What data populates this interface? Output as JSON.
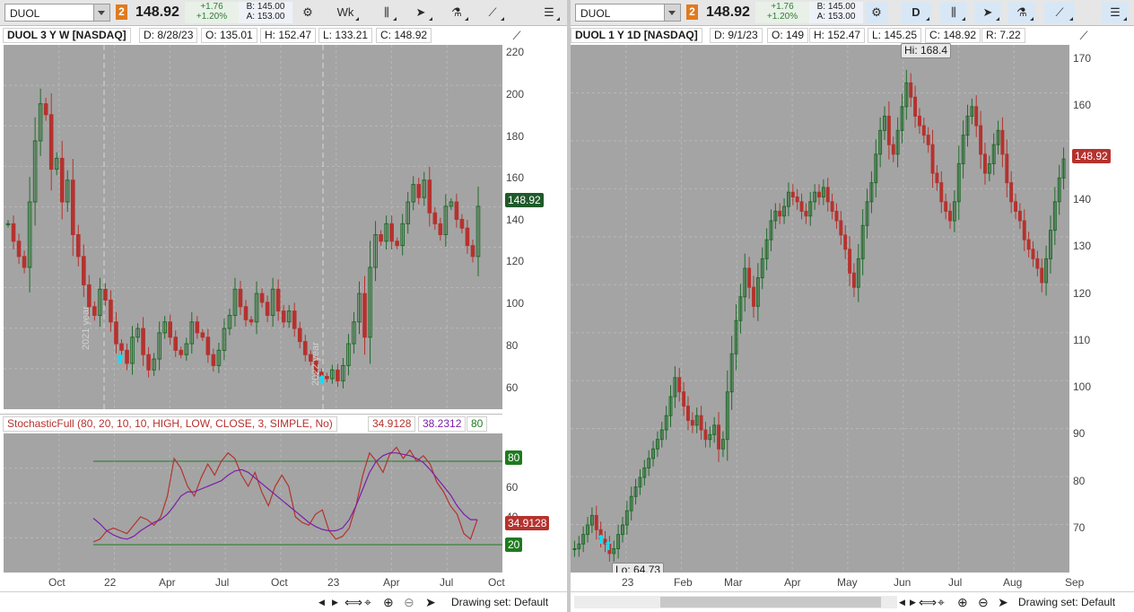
{
  "colors": {
    "up": "#1f6b2a",
    "down": "#b5322e",
    "plot_bg": "#a4a4a4",
    "stoch_k": "#b5322e",
    "stoch_d": "#7a1fa8",
    "level": "#1f7a1f",
    "arrow": "#00e5ff"
  },
  "left": {
    "symbol": "DUOL",
    "badge": "2",
    "last": "148.92",
    "change": "+1.76",
    "change_pct": "+1.20%",
    "bid": "B: 145.00",
    "ask": "A: 153.00",
    "aggregation": "Wk",
    "info": {
      "title": "DUOL 3 Y W [NASDAQ]",
      "date": "D: 8/28/23",
      "open": "O: 135.01",
      "high": "H: 152.47",
      "low": "L: 133.21",
      "close": "C: 148.92"
    },
    "price_tag": "148.92",
    "y_ticks": [
      "220",
      "200",
      "180",
      "160",
      "140",
      "120",
      "100",
      "80",
      "60"
    ],
    "x_ticks": [
      "Oct",
      "22",
      "Apr",
      "Jul",
      "Oct",
      "23",
      "Apr",
      "Jul",
      "Oct"
    ],
    "year_marks": [
      "2021 year",
      "2022 year"
    ],
    "study": {
      "label": "StochasticFull (80, 20, 10, 10, HIGH, LOW, CLOSE, 3, SIMPLE, No)",
      "k": "34.9128",
      "d": "38.2312",
      "ob": "80",
      "y_ticks": [
        "80",
        "60",
        "40",
        "20"
      ],
      "tag_k": "34.9128",
      "tag_ob": "80",
      "tag_os": "20"
    },
    "drawing_set": "Drawing set: Default"
  },
  "right": {
    "symbol": "DUOL",
    "badge": "2",
    "last": "148.92",
    "change": "+1.76",
    "change_pct": "+1.20%",
    "bid": "B: 145.00",
    "ask": "A: 153.00",
    "aggregation": "D",
    "info": {
      "title": "DUOL 1 Y 1D [NASDAQ]",
      "date": "D: 9/1/23",
      "open": "O: 149",
      "high": "H: 152.47",
      "low": "L: 145.25",
      "close": "C: 148.92",
      "range": "R: 7.22"
    },
    "price_tag": "148.92",
    "hi_label": "Hi: 168.4",
    "lo_label": "Lo: 64.73",
    "y_ticks": [
      "170",
      "160",
      "150",
      "140",
      "130",
      "120",
      "110",
      "100",
      "90",
      "80",
      "70"
    ],
    "x_ticks": [
      "23",
      "Feb",
      "Mar",
      "Apr",
      "May",
      "Jun",
      "Jul",
      "Aug",
      "Sep"
    ],
    "drawing_set": "Drawing set: Default"
  },
  "chart_data": [
    {
      "type": "candlestick",
      "title": "DUOL 3 Y W [NASDAQ]",
      "ylim": [
        55,
        222
      ],
      "closes": [
        140,
        132,
        125,
        120,
        150,
        178,
        195,
        190,
        165,
        170,
        150,
        160,
        135,
        125,
        112,
        102,
        98,
        110,
        105,
        95,
        85,
        82,
        76,
        88,
        92,
        80,
        73,
        78,
        90,
        95,
        88,
        82,
        80,
        85,
        95,
        90,
        88,
        80,
        75,
        82,
        92,
        98,
        110,
        102,
        96,
        95,
        108,
        104,
        98,
        110,
        100,
        95,
        100,
        92,
        86,
        80,
        77,
        72,
        70,
        69,
        73,
        68,
        75,
        85,
        95,
        108,
        88,
        120,
        135,
        132,
        140,
        132,
        130,
        140,
        150,
        158,
        152,
        160,
        145,
        140,
        135,
        148,
        150,
        142,
        138,
        130,
        125,
        148
      ],
      "stoch_k": [
        22,
        24,
        30,
        32,
        30,
        28,
        34,
        40,
        38,
        34,
        40,
        55,
        82,
        75,
        62,
        55,
        68,
        78,
        70,
        80,
        86,
        82,
        70,
        62,
        72,
        58,
        48,
        62,
        70,
        62,
        40,
        36,
        34,
        42,
        45,
        30,
        24,
        26,
        32,
        48,
        70,
        86,
        80,
        72,
        85,
        90,
        82,
        88,
        80,
        84,
        78,
        65,
        58,
        48,
        42,
        28,
        24,
        38
      ],
      "stoch_d": [
        39,
        35,
        30,
        27,
        25,
        24,
        26,
        30,
        33,
        36,
        38,
        42,
        48,
        55,
        58,
        58,
        60,
        62,
        64,
        66,
        70,
        73,
        74,
        72,
        68,
        64,
        60,
        56,
        52,
        48,
        44,
        40,
        36,
        33,
        31,
        30,
        30,
        32,
        38,
        48,
        60,
        72,
        80,
        84,
        86,
        86,
        85,
        84,
        82,
        79,
        74,
        68,
        62,
        56,
        48,
        42,
        38,
        38
      ]
    },
    {
      "type": "candlestick",
      "title": "DUOL 1 Y 1D [NASDAQ]",
      "ylim": [
        62,
        173
      ],
      "closes": [
        67,
        68,
        70,
        72,
        74,
        71,
        69,
        68,
        66,
        67,
        70,
        72,
        75,
        78,
        80,
        82,
        84,
        86,
        88,
        90,
        92,
        95,
        99,
        103,
        100,
        97,
        94,
        93,
        95,
        92,
        90,
        91,
        93,
        88,
        90,
        100,
        108,
        115,
        120,
        126,
        122,
        118,
        124,
        128,
        132,
        136,
        138,
        137,
        139,
        142,
        141,
        140,
        138,
        137,
        140,
        142,
        141,
        143,
        140,
        138,
        136,
        133,
        130,
        125,
        122,
        128,
        135,
        140,
        144,
        150,
        155,
        158,
        152,
        150,
        155,
        160,
        165,
        162,
        158,
        156,
        154,
        152,
        146,
        144,
        140,
        138,
        136,
        140,
        148,
        154,
        158,
        160,
        156,
        150,
        146,
        148,
        152,
        155,
        150,
        144,
        140,
        138,
        136,
        132,
        130,
        128,
        126,
        123,
        128,
        134,
        140,
        145,
        149
      ]
    }
  ]
}
